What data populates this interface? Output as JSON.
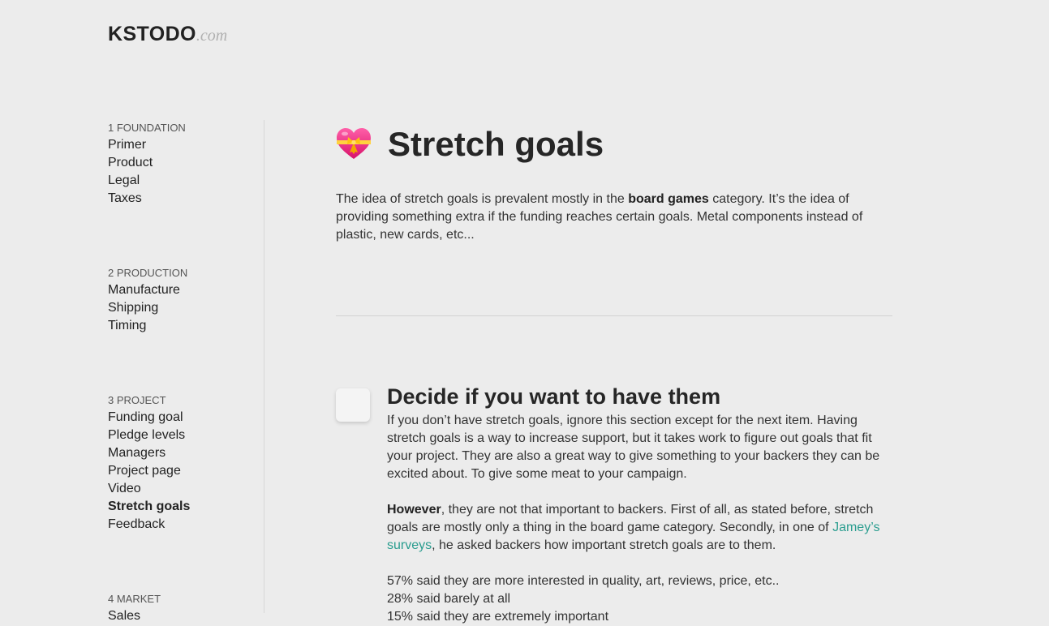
{
  "logo": {
    "main": "KSTODO",
    "tld": ".com"
  },
  "sidebar": {
    "sections": [
      {
        "heading": "1 FOUNDATION",
        "items": [
          "Primer",
          "Product",
          "Legal",
          "Taxes"
        ]
      },
      {
        "heading": "2 PRODUCTION",
        "items": [
          "Manufacture",
          "Shipping",
          "Timing"
        ]
      },
      {
        "heading": "3 PROJECT",
        "items": [
          "Funding goal",
          "Pledge levels",
          "Managers",
          "Project page",
          "Video",
          "Stretch goals",
          "Feedback"
        ]
      },
      {
        "heading": "4 MARKET",
        "items": [
          "Sales"
        ]
      }
    ],
    "active_item": "Stretch goals"
  },
  "page": {
    "icon": "sparkling-heart-with-ribbon-icon",
    "title": "Stretch goals",
    "intro": {
      "before": "The idea of stretch goals is prevalent mostly in the ",
      "bold": "board games",
      "after": " category. It’s the idea of providing something extra if the funding reaches certain goals. Metal components instead of plastic, new cards, etc..."
    }
  },
  "task": {
    "checked": false,
    "title": "Decide if you want to have them",
    "p1": "If you don’t have stretch goals, ignore this section except for the next item. Having stretch goals is a way to increase support, but it takes work to figure out goals that fit your project. They are also a great way to give something to your backers they can be excited about. To give some meat to your campaign.",
    "p2": {
      "bold": "However",
      "part1": ", they are not that important to backers. First of all, as stated before, stretch goals are mostly only a thing in the board game category. Secondly, in one of ",
      "link": "Jamey’s surveys",
      "part2": ", he asked backers how important stretch goals are to them."
    },
    "stats": [
      "57% said they are more interested in quality, art, reviews, price, etc..",
      "28% said barely at all",
      "15% said they are extremely important"
    ]
  },
  "colors": {
    "background": "#ececec",
    "link": "#2a9d8f",
    "text": "#333333"
  }
}
